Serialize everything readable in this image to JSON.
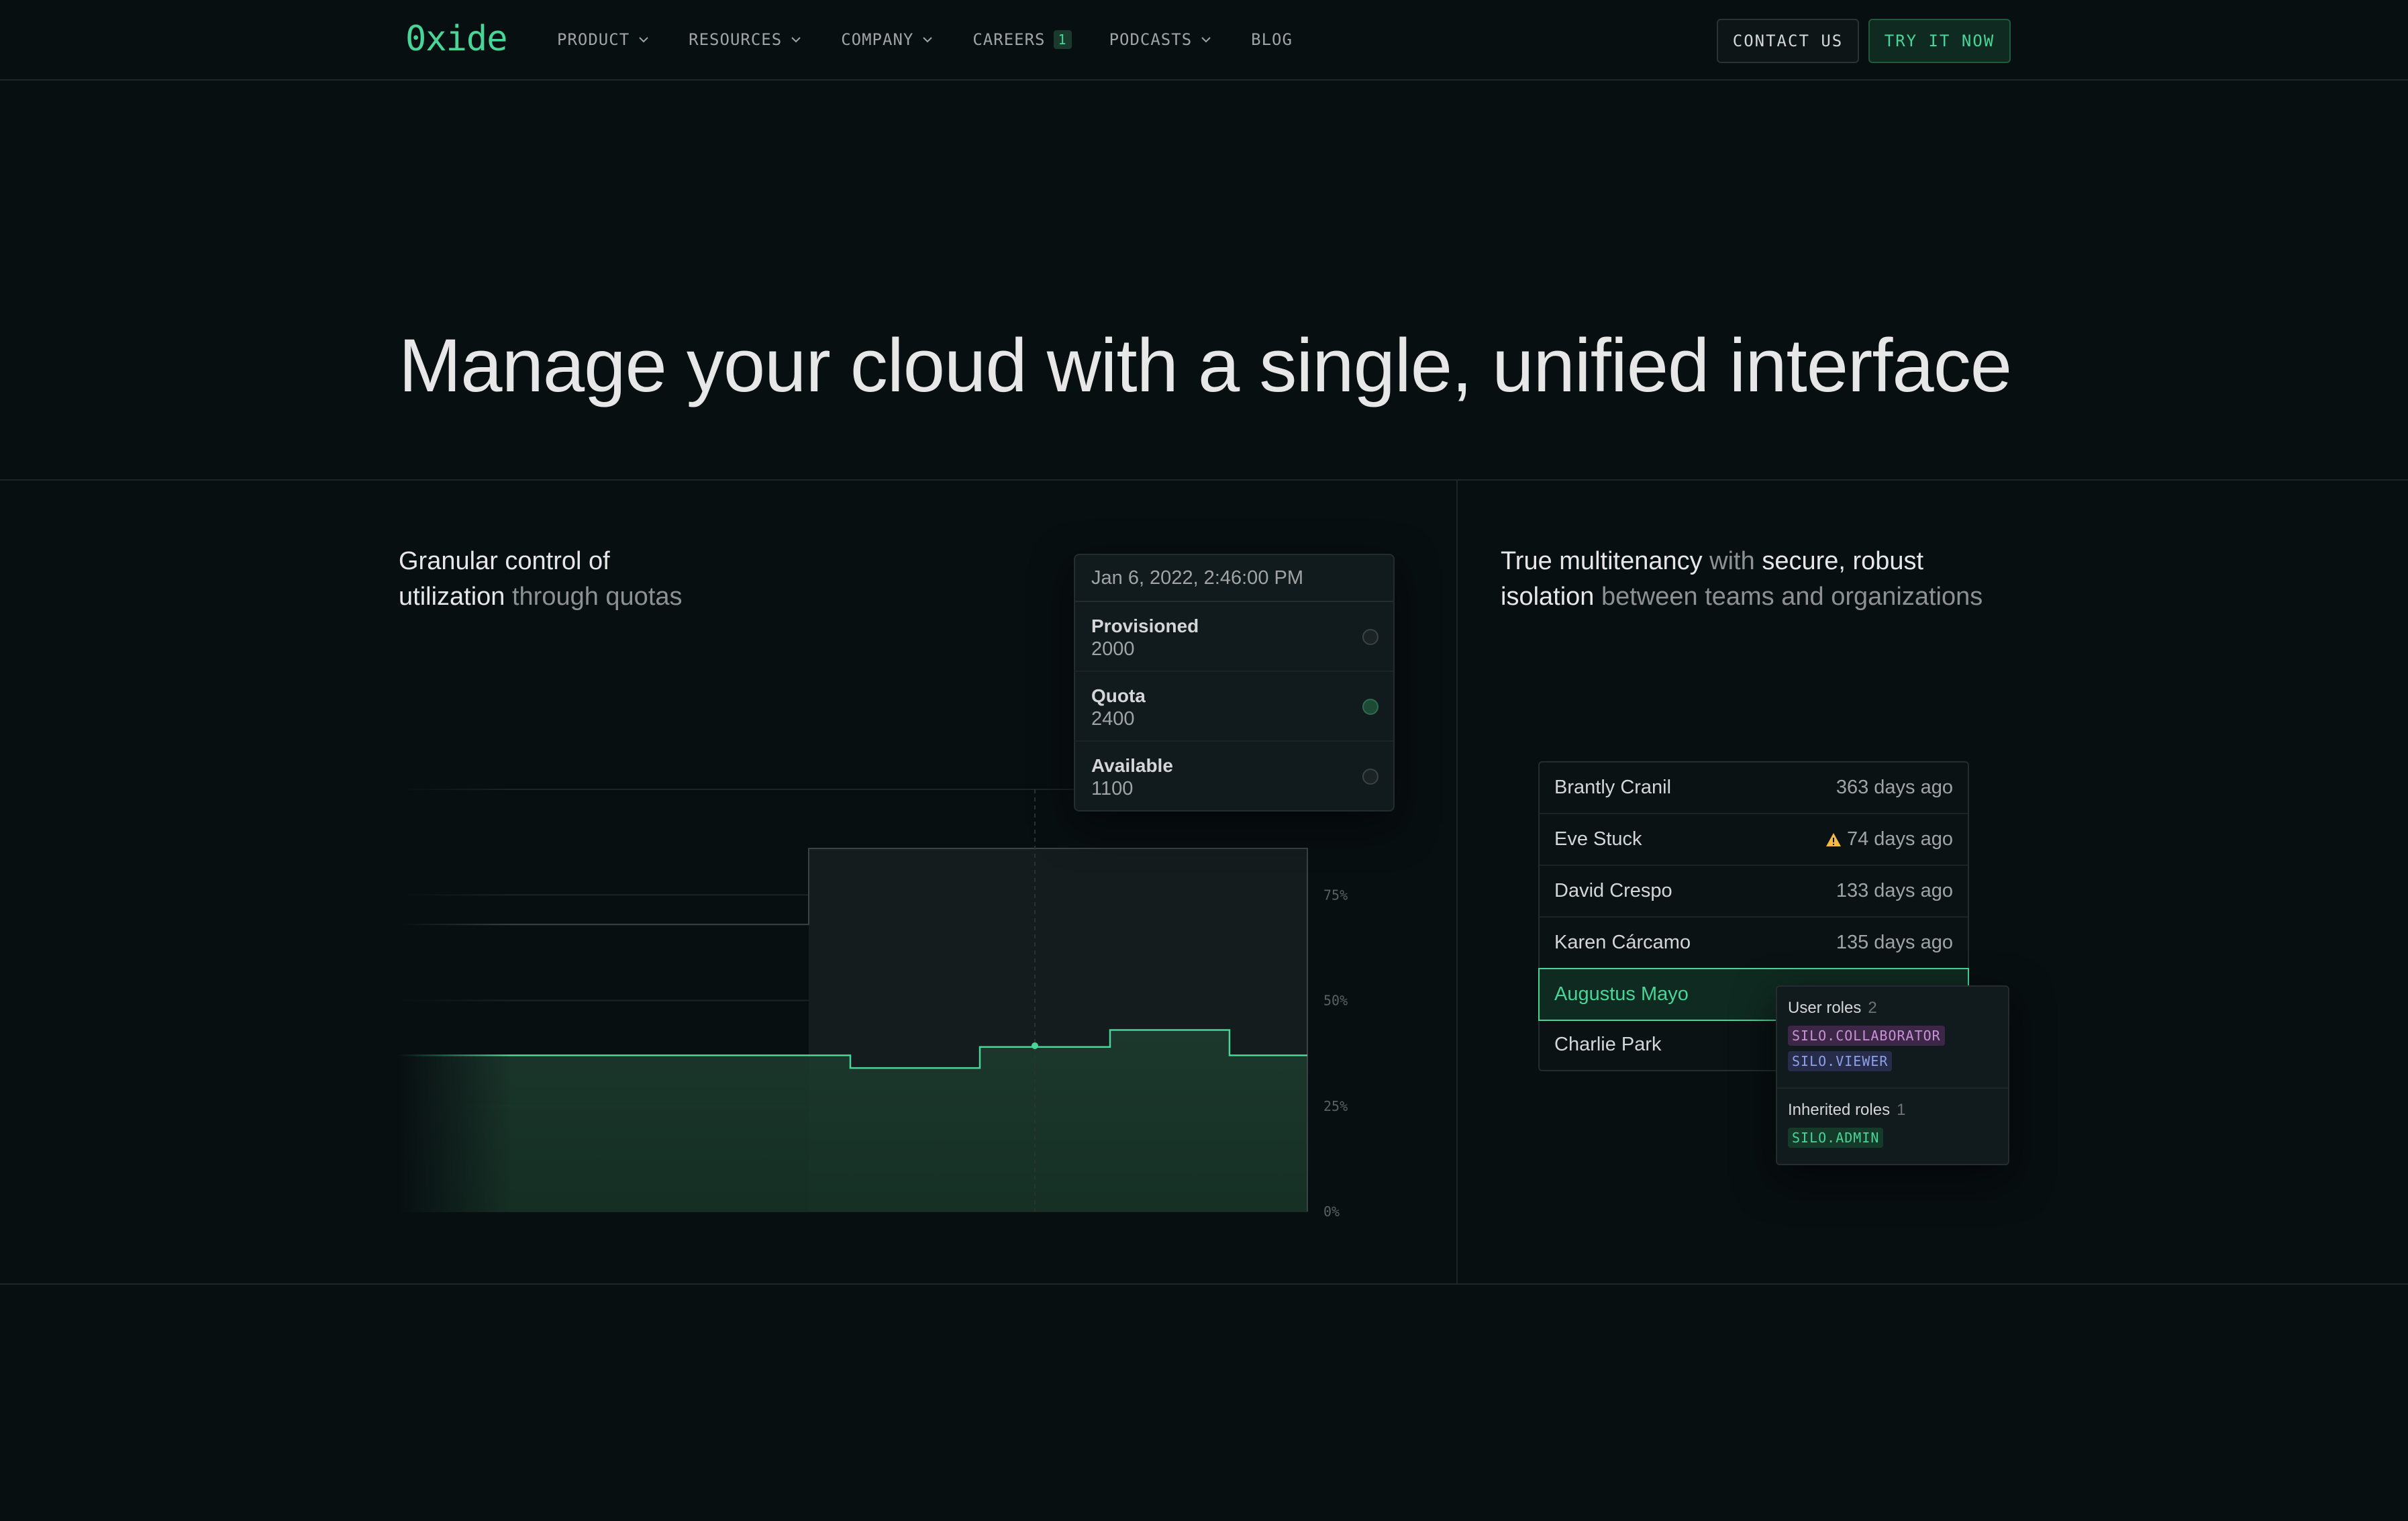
{
  "nav": {
    "logo": "0xide",
    "items": [
      {
        "label": "PRODUCT",
        "dropdown": true
      },
      {
        "label": "RESOURCES",
        "dropdown": true
      },
      {
        "label": "COMPANY",
        "dropdown": true
      },
      {
        "label": "CAREERS",
        "badge": "1"
      },
      {
        "label": "PODCASTS",
        "dropdown": true
      },
      {
        "label": "BLOG"
      }
    ],
    "contact_label": "CONTACT US",
    "try_label": "TRY IT NOW"
  },
  "hero": {
    "title": "Manage your cloud with a single, unified interface"
  },
  "quota_feature": {
    "text_line1_hl": "Granular control of",
    "text_line2_hl": "utilization",
    "text_line2_rest": " through quotas"
  },
  "tooltip": {
    "date": "Jan 6, 2022, 2:46:00 PM",
    "rows": [
      {
        "label": "Provisioned",
        "value": "2000",
        "dot": "gray"
      },
      {
        "label": "Quota",
        "value": "2400",
        "dot": "green"
      },
      {
        "label": "Available",
        "value": "1100",
        "dot": "gray"
      }
    ]
  },
  "chart_data": {
    "type": "area",
    "y_tick_labels": [
      "75%",
      "50%",
      "25%",
      "0%"
    ],
    "ylim": [
      0,
      100
    ],
    "series": [
      {
        "kind": "step-line",
        "color": "#3b4345",
        "values": [
          68,
          68,
          68,
          86,
          86,
          86,
          86,
          86,
          86
        ]
      },
      {
        "kind": "step-area",
        "color": "#48d597",
        "values": [
          37,
          37,
          37,
          34,
          39,
          43,
          37,
          37,
          37
        ]
      }
    ],
    "grid": true
  },
  "tenancy_feature": {
    "line1_hl": "True multitenancy",
    "line1_mid": " with ",
    "line1_hl2": "secure, robust",
    "line2_hl": "isolation",
    "line2_rest": " between teams and organizations"
  },
  "users": [
    {
      "name": "Brantly Cranil",
      "ago": "363 days ago",
      "warning": false
    },
    {
      "name": "Eve Stuck",
      "ago": "74 days ago",
      "warning": true
    },
    {
      "name": "David Crespo",
      "ago": "133 days ago",
      "warning": false
    },
    {
      "name": "Karen Cárcamo",
      "ago": "135 days ago",
      "warning": false
    },
    {
      "name": "Augustus Mayo",
      "ago": "",
      "warning": false,
      "active": true
    },
    {
      "name": "Charlie Park",
      "ago": "",
      "warning": false
    }
  ],
  "roles_popup": {
    "user_roles_title": "User roles",
    "user_roles_count": "2",
    "user_roles": [
      "SILO.COLLABORATOR",
      "SILO.VIEWER"
    ],
    "inherited_title": "Inherited roles",
    "inherited_count": "1",
    "inherited_roles": [
      "SILO.ADMIN"
    ]
  },
  "colors": {
    "accent": "#48d597",
    "background": "#080f11",
    "border": "#1f2628"
  }
}
